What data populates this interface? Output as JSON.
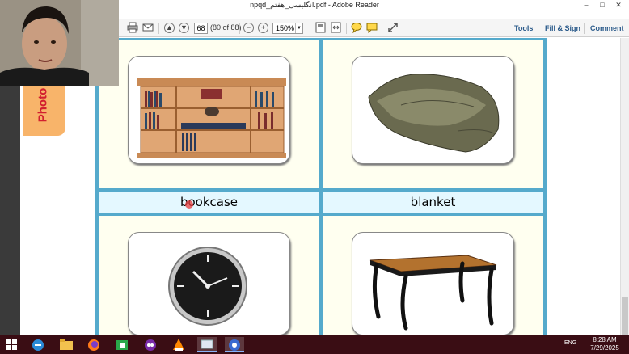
{
  "window": {
    "title": "npqd_انگلیسی_هفتم.pdf - Adobe Reader",
    "minimize_glyph": "–",
    "maximize_glyph": "□",
    "close_glyph": "✕"
  },
  "toolbar": {
    "page_number": "68",
    "page_count": "(80 of 88)",
    "zoom": "150%",
    "zoom_out_glyph": "−",
    "zoom_in_glyph": "+",
    "tools_label": "Tools",
    "fill_sign_label": "Fill & Sign",
    "comment_label": "Comment",
    "icons": [
      "open-icon",
      "print-icon",
      "email-icon",
      "previous-page-icon",
      "next-page-icon",
      "zoom-out-icon",
      "zoom-in-icon",
      "fit-page-icon",
      "fit-width-icon",
      "comment-bubble-icon",
      "highlight-icon",
      "expand-icon"
    ]
  },
  "side_tab": {
    "label": "Photo"
  },
  "document": {
    "labels": [
      "bookcase",
      "blanket"
    ],
    "pictures": [
      "bookcase-picture",
      "blanket-picture",
      "wall-clock-picture",
      "table-picture"
    ]
  },
  "taskbar": {
    "icons": [
      "windows-start-icon",
      "edge-icon",
      "file-explorer-icon",
      "firefox-icon",
      "store-icon",
      "app-icon",
      "vlc-icon",
      "screen-app-icon",
      "recorder-icon"
    ],
    "tray_lang": "ENG",
    "time": "8:28 AM",
    "date": "7/29/2025"
  }
}
